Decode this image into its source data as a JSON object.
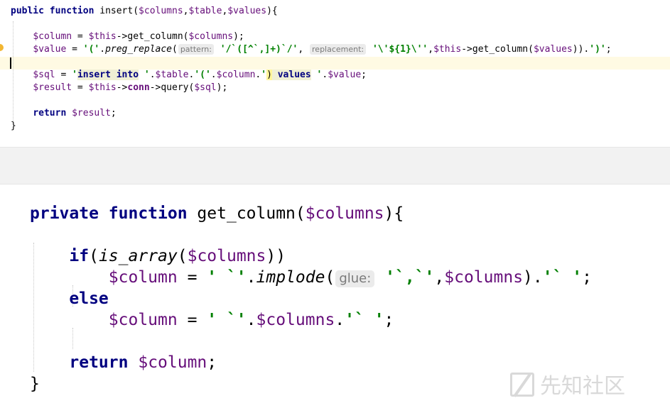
{
  "editor_top": {
    "lines": [
      {
        "parts": [
          {
            "t": "public",
            "c": "kw"
          },
          {
            "t": " "
          },
          {
            "t": "function",
            "c": "kw"
          },
          {
            "t": " insert("
          },
          {
            "t": "$columns",
            "c": "var"
          },
          {
            "t": ","
          },
          {
            "t": "$table",
            "c": "var"
          },
          {
            "t": ","
          },
          {
            "t": "$values",
            "c": "var"
          },
          {
            "t": "){"
          }
        ]
      },
      {
        "parts": []
      },
      {
        "parts": [
          {
            "t": "    "
          },
          {
            "t": "$column",
            "c": "var"
          },
          {
            "t": " = "
          },
          {
            "t": "$this",
            "c": "var"
          },
          {
            "t": "->get_column("
          },
          {
            "t": "$columns",
            "c": "var"
          },
          {
            "t": ");"
          }
        ]
      },
      {
        "parts": [
          {
            "t": "    "
          },
          {
            "t": "$value",
            "c": "var"
          },
          {
            "t": " = "
          },
          {
            "t": "'('",
            "c": "str"
          },
          {
            "t": "."
          },
          {
            "t": "preg_replace",
            "c": "fn-italic"
          },
          {
            "t": "("
          },
          {
            "t": "pattern:",
            "c": "hint"
          },
          {
            "t": " "
          },
          {
            "t": "'/`([^`,]+)`/'",
            "c": "str"
          },
          {
            "t": ", "
          },
          {
            "t": "replacement:",
            "c": "hint"
          },
          {
            "t": " "
          },
          {
            "t": "'\\'${1}\\''",
            "c": "str"
          },
          {
            "t": ","
          },
          {
            "t": "$this",
            "c": "var"
          },
          {
            "t": "->get_column("
          },
          {
            "t": "$values",
            "c": "var"
          },
          {
            "t": "))."
          },
          {
            "t": "')'",
            "c": "str"
          },
          {
            "t": ";"
          }
        ]
      },
      {
        "parts": []
      },
      {
        "parts": [
          {
            "t": "    "
          },
          {
            "t": "$sql",
            "c": "var"
          },
          {
            "t": " = "
          },
          {
            "t": "'",
            "c": "str"
          },
          {
            "t": "insert into",
            "c": "kw sql-hl"
          },
          {
            "t": " '",
            "c": "str"
          },
          {
            "t": "."
          },
          {
            "t": "$table",
            "c": "var"
          },
          {
            "t": "."
          },
          {
            "t": "'('",
            "c": "str"
          },
          {
            "t": "."
          },
          {
            "t": "$column",
            "c": "var"
          },
          {
            "t": "."
          },
          {
            "t": "'",
            "c": "str"
          },
          {
            "t": ")",
            "c": "brace-hl"
          },
          {
            "t": " ",
            "c": "sql-hl"
          },
          {
            "t": "values",
            "c": "kw sql-hl"
          },
          {
            "t": " '",
            "c": "str"
          },
          {
            "t": "."
          },
          {
            "t": "$value",
            "c": "var"
          },
          {
            "t": ";"
          }
        ]
      },
      {
        "parts": [
          {
            "t": "    "
          },
          {
            "t": "$result",
            "c": "var"
          },
          {
            "t": " = "
          },
          {
            "t": "$this",
            "c": "var"
          },
          {
            "t": "->"
          },
          {
            "t": "conn",
            "c": "conn"
          },
          {
            "t": "->query("
          },
          {
            "t": "$sql",
            "c": "var"
          },
          {
            "t": ");"
          }
        ]
      },
      {
        "parts": []
      },
      {
        "parts": [
          {
            "t": "    "
          },
          {
            "t": "return",
            "c": "kw"
          },
          {
            "t": " "
          },
          {
            "t": "$result",
            "c": "var"
          },
          {
            "t": ";"
          }
        ]
      },
      {
        "parts": [
          {
            "t": "}"
          }
        ]
      }
    ]
  },
  "editor_bottom": {
    "lines": [
      {
        "parts": [
          {
            "t": "private",
            "c": "kw"
          },
          {
            "t": " "
          },
          {
            "t": "function",
            "c": "kw"
          },
          {
            "t": " get_column("
          },
          {
            "t": "$columns",
            "c": "var"
          },
          {
            "t": "){"
          }
        ]
      },
      {
        "parts": []
      },
      {
        "parts": [
          {
            "t": "    "
          },
          {
            "t": "if",
            "c": "kw"
          },
          {
            "t": "("
          },
          {
            "t": "is_array",
            "c": "fn-italic"
          },
          {
            "t": "("
          },
          {
            "t": "$columns",
            "c": "var"
          },
          {
            "t": "))"
          }
        ]
      },
      {
        "parts": [
          {
            "t": "        "
          },
          {
            "t": "$column",
            "c": "var"
          },
          {
            "t": " = "
          },
          {
            "t": "' `'",
            "c": "str"
          },
          {
            "t": "."
          },
          {
            "t": "implode",
            "c": "fn-italic"
          },
          {
            "t": "("
          },
          {
            "t": "glue:",
            "c": "hint"
          },
          {
            "t": " "
          },
          {
            "t": "'`,`'",
            "c": "str"
          },
          {
            "t": ","
          },
          {
            "t": "$columns",
            "c": "var"
          },
          {
            "t": ")."
          },
          {
            "t": "'` '",
            "c": "str"
          },
          {
            "t": ";"
          }
        ]
      },
      {
        "parts": [
          {
            "t": "    "
          },
          {
            "t": "else",
            "c": "kw"
          }
        ]
      },
      {
        "parts": [
          {
            "t": "        "
          },
          {
            "t": "$column",
            "c": "var"
          },
          {
            "t": " = "
          },
          {
            "t": "' `'",
            "c": "str"
          },
          {
            "t": "."
          },
          {
            "t": "$columns",
            "c": "var"
          },
          {
            "t": "."
          },
          {
            "t": "'` '",
            "c": "str"
          },
          {
            "t": ";"
          }
        ]
      },
      {
        "parts": []
      },
      {
        "parts": [
          {
            "t": "    "
          },
          {
            "t": "return",
            "c": "kw"
          },
          {
            "t": " "
          },
          {
            "t": "$column",
            "c": "var"
          },
          {
            "t": ";"
          }
        ]
      },
      {
        "parts": [
          {
            "t": "}"
          }
        ]
      }
    ]
  },
  "watermark": {
    "text": "先知社区",
    "icon": "xianzhi-logo-icon"
  }
}
